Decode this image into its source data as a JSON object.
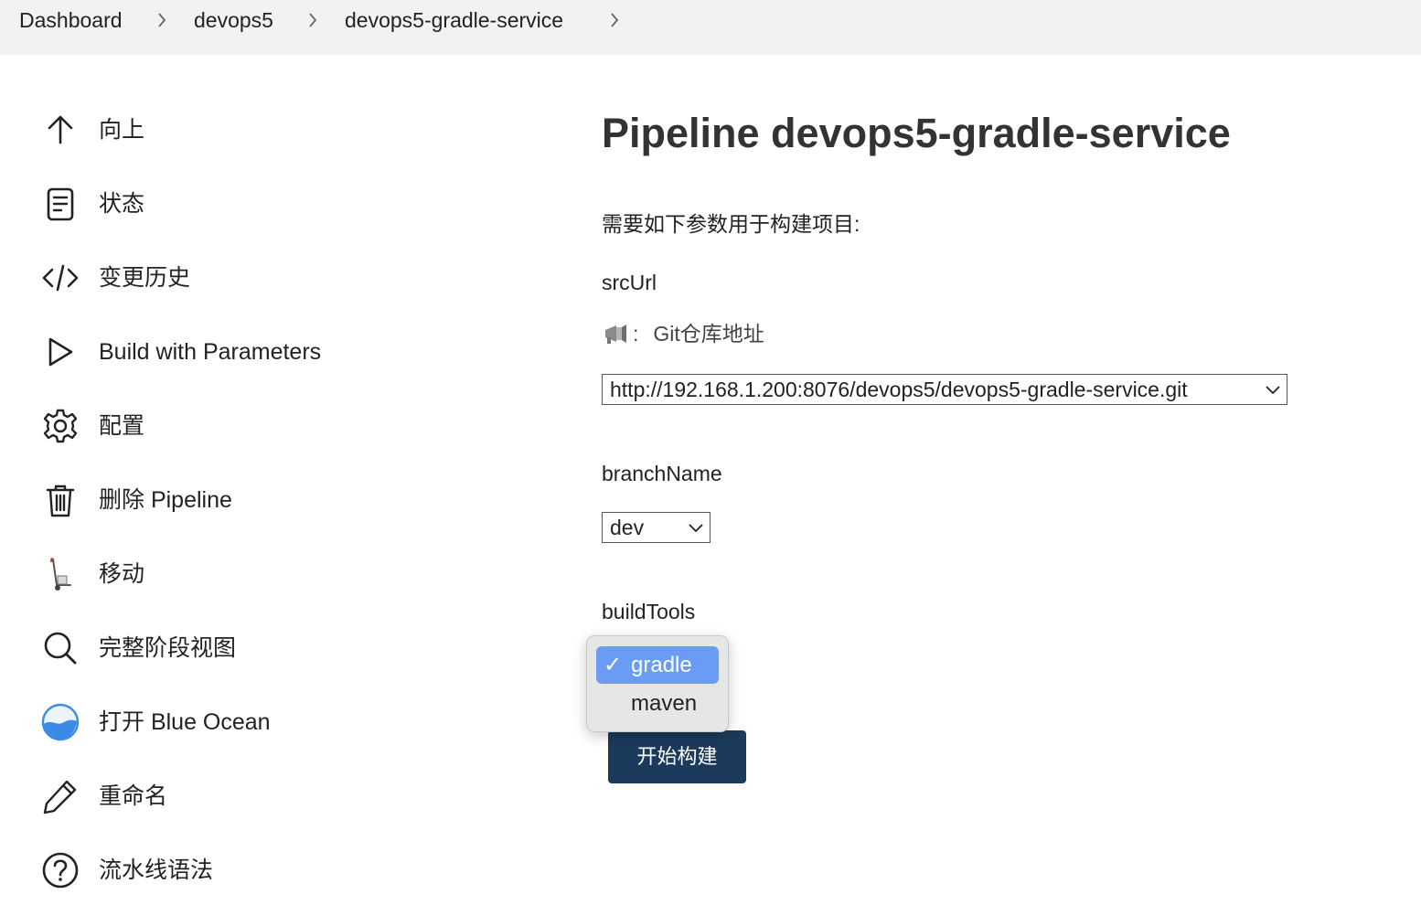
{
  "breadcrumb": {
    "items": [
      "Dashboard",
      "devops5",
      "devops5-gradle-service"
    ]
  },
  "sidebar": {
    "items": [
      {
        "label": "向上",
        "icon": "arrow-up-icon"
      },
      {
        "label": "状态",
        "icon": "document-icon"
      },
      {
        "label": "变更历史",
        "icon": "code-icon"
      },
      {
        "label": "Build with Parameters",
        "icon": "play-icon"
      },
      {
        "label": "配置",
        "icon": "gear-icon"
      },
      {
        "label": "删除 Pipeline",
        "icon": "trash-icon"
      },
      {
        "label": "移动",
        "icon": "hand-truck-icon"
      },
      {
        "label": "完整阶段视图",
        "icon": "search-icon"
      },
      {
        "label": "打开 Blue Ocean",
        "icon": "blue-ocean-icon"
      },
      {
        "label": "重命名",
        "icon": "pencil-icon"
      },
      {
        "label": "流水线语法",
        "icon": "help-icon"
      }
    ]
  },
  "main": {
    "title": "Pipeline devops5-gradle-service",
    "intro": "需要如下参数用于构建项目:",
    "params": {
      "src_url": {
        "name": "srcUrl",
        "description_colon": ":",
        "description": "Git仓库地址",
        "value": "http://192.168.1.200:8076/devops5/devops5-gradle-service.git"
      },
      "branch_name": {
        "name": "branchName",
        "value": "dev"
      },
      "build_tools": {
        "name": "buildTools",
        "options": [
          {
            "label": "gradle",
            "selected": true
          },
          {
            "label": "maven",
            "selected": false
          }
        ],
        "check_mark": "✓"
      }
    },
    "build_button": "开始构建"
  },
  "colors": {
    "topbar_bg": "#f2f2f2",
    "selected_option": "#6a9bf5",
    "build_button_bg": "#1b3a5c",
    "blue_ocean": "#3b8ae6"
  }
}
